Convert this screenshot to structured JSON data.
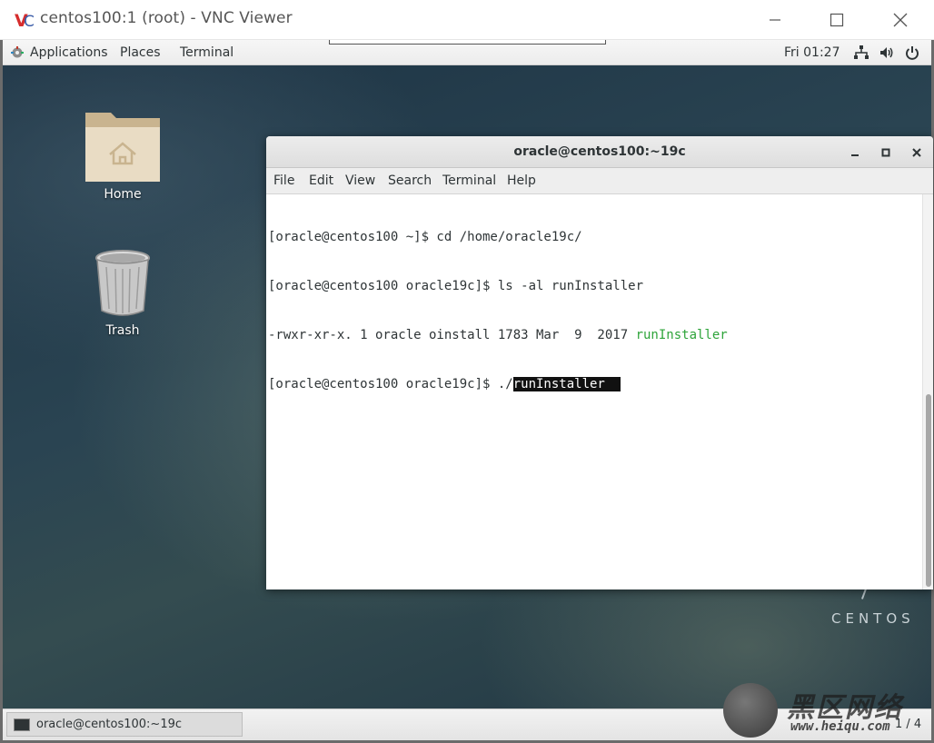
{
  "vnc": {
    "title": "centos100:1 (root) - VNC Viewer",
    "logo_text": "VC"
  },
  "topbar": {
    "applications": "Applications",
    "places": "Places",
    "terminal": "Terminal",
    "clock": "Fri 01:27"
  },
  "desktop": {
    "icons": [
      {
        "label": "Home"
      },
      {
        "label": "Trash"
      }
    ],
    "brand": "CENTOS"
  },
  "terminal": {
    "title": "oracle@centos100:~19c",
    "menu": [
      "File",
      "Edit",
      "View",
      "Search",
      "Terminal",
      "Help"
    ],
    "lines": {
      "l1": "[oracle@centos100 ~]$ cd /home/oracle19c/",
      "l2": "[oracle@centos100 oracle19c]$ ls -al runInstaller",
      "l3_prefix": "-rwxr-xr-x. 1 oracle oinstall 1783 Mar  9  2017 ",
      "l3_file": "runInstaller",
      "l4_prompt": "[oracle@centos100 oracle19c]$ ./",
      "l4_selected": "runInstaller  "
    },
    "colors": {
      "exec_file": "#2ea43a",
      "selection_bg": "#111111"
    }
  },
  "taskbar": {
    "item_label": "oracle@centos100:~19c",
    "workspace": "1 / 4"
  },
  "watermark": {
    "brand": "黑区网络",
    "url": "www.heiqu.com"
  }
}
